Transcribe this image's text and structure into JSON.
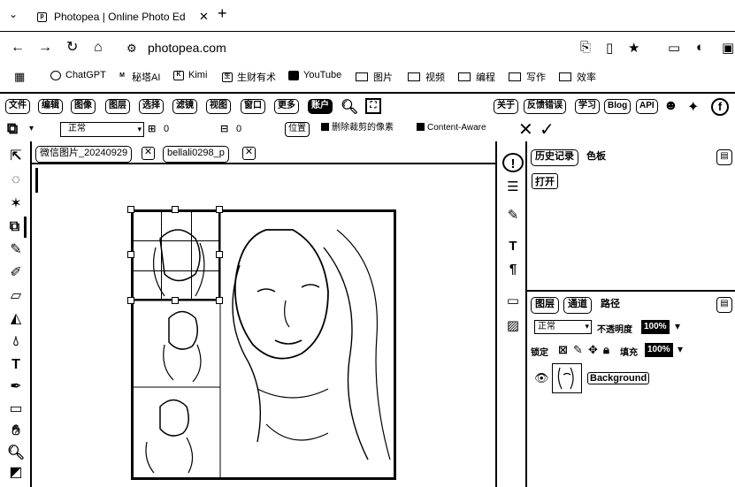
{
  "browser": {
    "tab_title": "Photopea | Online Photo Ed",
    "url": "photopea.com",
    "bookmarks": [
      {
        "label": "ChatGPT"
      },
      {
        "label": "秘塔AI"
      },
      {
        "label": "Kimi"
      },
      {
        "label": "生财有术"
      },
      {
        "label": "YouTube"
      },
      {
        "label": "图片"
      },
      {
        "label": "视频"
      },
      {
        "label": "编程"
      },
      {
        "label": "写作"
      },
      {
        "label": "效率"
      }
    ]
  },
  "menubar": {
    "items": [
      "文件",
      "编辑",
      "图像",
      "图层",
      "选择",
      "滤镜",
      "视图",
      "窗口",
      "更多",
      "账户"
    ],
    "right_items": [
      "关于",
      "反馈错误",
      "学习",
      "Blog",
      "API"
    ]
  },
  "options": {
    "mode_value": "正常",
    "w_value": "0",
    "h_value": "0",
    "position_label": "位置",
    "delete_cropped_label": "删除裁剪的像素",
    "content_aware_label": "Content-Aware"
  },
  "documents": {
    "tabs": [
      {
        "label": "微信图片_20240929"
      },
      {
        "label": "bellali0298_p"
      }
    ]
  },
  "history_panel": {
    "tabs": [
      "历史记录",
      "色板"
    ],
    "items": [
      "打开"
    ]
  },
  "layers_panel": {
    "tabs": [
      "图层",
      "通道",
      "路径"
    ],
    "blend_mode": "正常",
    "opacity_label": "不透明度",
    "opacity_value": "100%",
    "lock_label": "锁定",
    "fill_label": "填充",
    "fill_value": "100%",
    "layers": [
      {
        "name": "Background"
      }
    ]
  }
}
